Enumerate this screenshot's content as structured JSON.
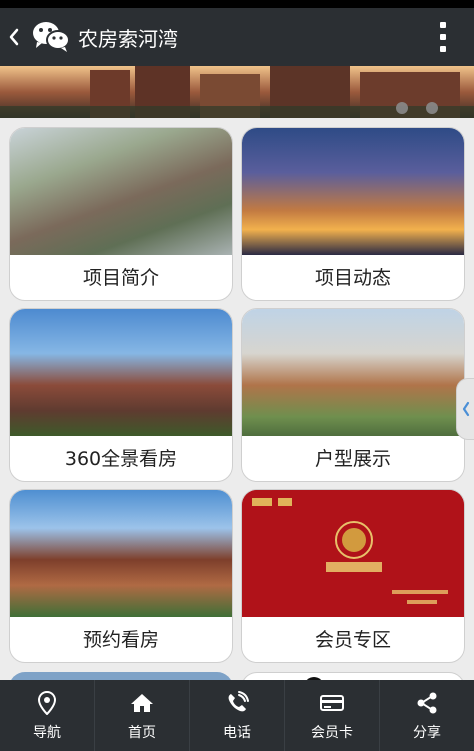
{
  "header": {
    "title": "农房索河湾"
  },
  "cards": [
    {
      "label": "项目简介"
    },
    {
      "label": "项目动态"
    },
    {
      "label": "360全景看房"
    },
    {
      "label": "户型展示"
    },
    {
      "label": "预约看房"
    },
    {
      "label": "会员专区"
    }
  ],
  "tabs": [
    {
      "label": "导航",
      "icon": "location-pin-icon"
    },
    {
      "label": "首页",
      "icon": "home-icon"
    },
    {
      "label": "电话",
      "icon": "phone-icon"
    },
    {
      "label": "会员卡",
      "icon": "card-icon"
    },
    {
      "label": "分享",
      "icon": "share-icon"
    }
  ]
}
